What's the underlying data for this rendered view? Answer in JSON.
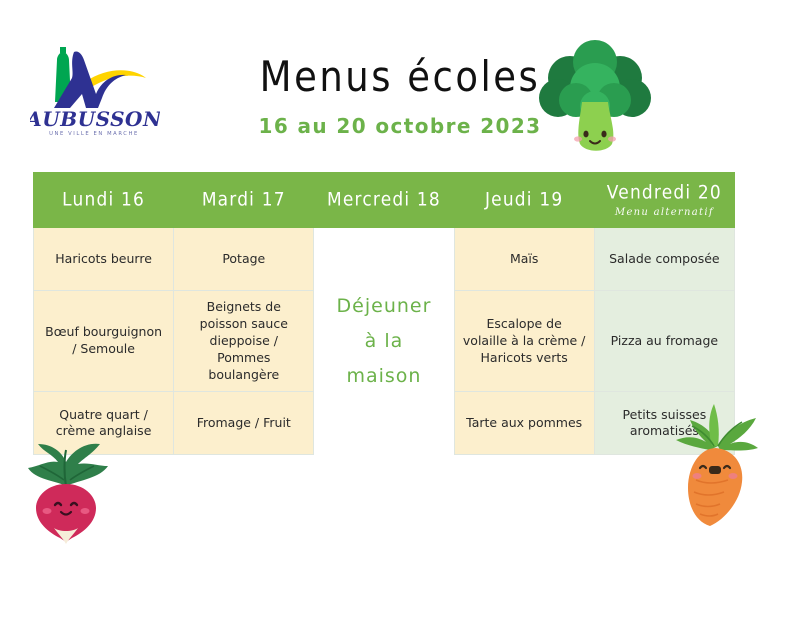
{
  "logo": {
    "name": "AUBUSSON",
    "tagline": "UNE VILLE EN MARCHE",
    "colors": {
      "navy": "#2e3192",
      "green": "#00a651",
      "yellow": "#ffd400"
    }
  },
  "header": {
    "title": "Menus écoles",
    "subtitle": "16 au 20 octobre 2023",
    "title_color": "#111111",
    "subtitle_color": "#6cb24a"
  },
  "table": {
    "header_bg": "#7ab648",
    "header_text_color": "#ffffff",
    "cell_bg": "#fcefcd",
    "friday_cell_bg": "#e4eedf",
    "home_cell_bg": "#ffffff",
    "home_text_color": "#6cb24a",
    "columns": [
      {
        "day": "Lundi 16",
        "note": ""
      },
      {
        "day": "Mardi 17",
        "note": ""
      },
      {
        "day": "Mercredi 18",
        "note": ""
      },
      {
        "day": "Jeudi 19",
        "note": ""
      },
      {
        "day": "Vendredi 20",
        "note": "Menu alternatif"
      }
    ],
    "rows": [
      {
        "name": "entree",
        "cells": [
          "Haricots beurre",
          "Potage",
          "",
          "Maïs",
          "Salade composée"
        ]
      },
      {
        "name": "plat",
        "cells": [
          "Bœuf bourguignon / Semoule",
          "Beignets de poisson sauce dieppoise  / Pommes boulangère",
          "",
          "Escalope de volaille à la crème / Haricots verts",
          "Pizza au fromage"
        ]
      },
      {
        "name": "dessert",
        "cells": [
          "Quatre quart / crème anglaise",
          "Fromage / Fruit",
          "",
          "Tarte aux pommes",
          "Petits suisses aromatisés"
        ]
      }
    ],
    "merged_wednesday": {
      "line1": "Déjeuner",
      "line2": "à la",
      "line3": "maison"
    }
  },
  "decorations": {
    "broccoli": "broccoli-mascot",
    "radish": "radish-mascot",
    "carrot": "carrot-mascot"
  }
}
